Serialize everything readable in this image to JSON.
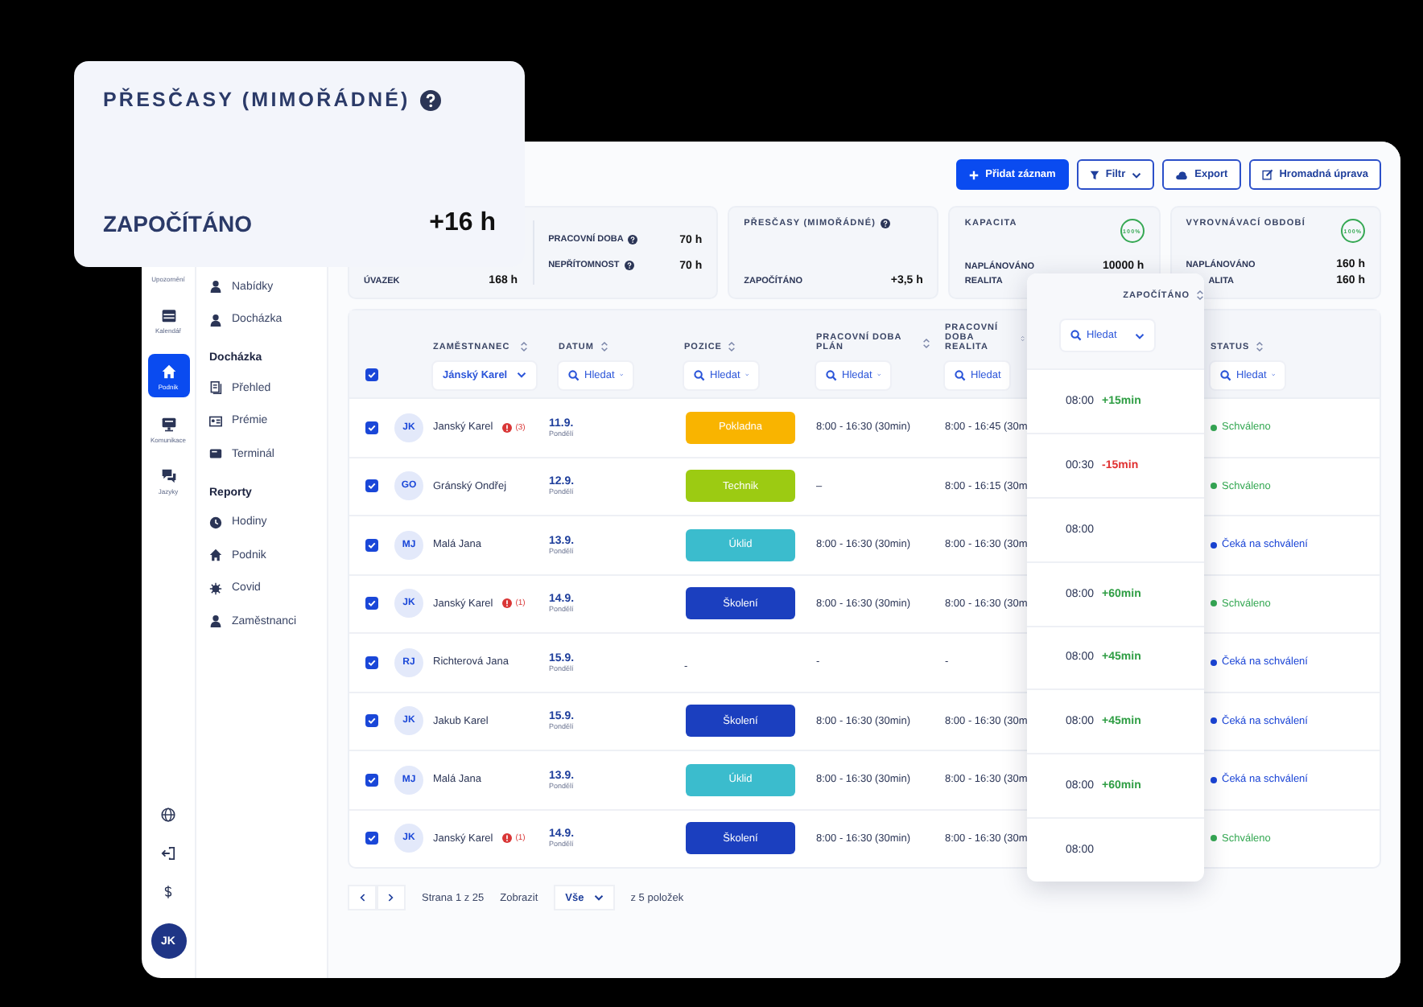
{
  "overlay_card": {
    "title": "PŘESČASY (MIMOŘÁDNÉ)",
    "help": true,
    "label": "ZAPOČÍTÁNO",
    "value": "+16 h"
  },
  "rail": {
    "items": [
      {
        "label": "Upozornění",
        "selected": false
      },
      {
        "label": "Kalendář",
        "selected": false
      },
      {
        "label": "Podnik",
        "selected": true
      },
      {
        "label": "Komunikace",
        "selected": false
      },
      {
        "label": "Jazyky",
        "selected": false
      }
    ],
    "avatar": "JK"
  },
  "nav": [
    {
      "items": [
        "Nabídky",
        "Docházka"
      ]
    },
    {
      "heading": "Docházka",
      "items": [
        "Přehled",
        "Prémie",
        "Terminál"
      ]
    },
    {
      "heading": "Reporty",
      "items": [
        "Hodiny",
        "Podnik",
        "Covid",
        "Zaměstnanci"
      ]
    }
  ],
  "toolbar": [
    {
      "label": "Přidat záznam",
      "kind": "primary"
    },
    {
      "label": "Filtr",
      "kind": "dropdown"
    },
    {
      "label": "Export",
      "kind": "export"
    },
    {
      "label": "Hromadná úprava",
      "kind": "edit"
    }
  ],
  "summary": [
    {
      "kind": "split",
      "rows": [
        {
          "label": "ÚVAZEK",
          "value": "168 h"
        }
      ],
      "side_rows": [
        {
          "label": "PRACOVNÍ DOBA",
          "value": "70 h",
          "help": true
        },
        {
          "label": "NEPŘÍTOMNOST",
          "value": "70 h",
          "help": true
        }
      ]
    },
    {
      "kind": "plain",
      "title": "PŘESČASY (MIMOŘÁDNÉ)",
      "help": true,
      "rows": [
        {
          "label": "ZAPOČÍTÁNO",
          "value": "+3,5 h"
        }
      ]
    },
    {
      "kind": "gauge",
      "title": "KAPACITA",
      "badge": "100%",
      "rows": [
        {
          "label": "NAPLÁNOVÁNO",
          "value": "10000 h"
        },
        {
          "label": "REALITA"
        }
      ]
    },
    {
      "kind": "gauge",
      "title": "VYROVNÁVACÍ OBDOBÍ",
      "badge": "100%",
      "rows": [
        {
          "label": "NAPLÁNOVÁNO",
          "value": "160 h"
        },
        {
          "label": "ALITA",
          "value": "160 h"
        }
      ]
    }
  ],
  "table": {
    "all_checked": true,
    "columns": [
      {
        "label": "ZAMĚSTNANEC",
        "filter": {
          "value": "Jánský Karel"
        }
      },
      {
        "label": "DATUM",
        "filter": {
          "placeholder": "Hledat"
        }
      },
      {
        "label": "POZICE",
        "filter": {
          "placeholder": "Hledat"
        }
      },
      {
        "label": "PRACOVNÍ DOBA PLÁN",
        "filter": {
          "placeholder": "Hledat"
        }
      },
      {
        "label": "PRACOVNÍ DOBA REALITA",
        "filter": {
          "placeholder": "Hledat"
        }
      },
      {
        "label": "STATUS",
        "filter": {
          "placeholder": "Hledat"
        }
      }
    ],
    "rows": [
      {
        "checked": true,
        "initials": "JK",
        "name": "Janský Karel",
        "alert": "(3)",
        "date": "11.9.",
        "day": "Pondělí",
        "position": {
          "label": "Pokladna",
          "color": "#f9b400"
        },
        "plan": "8:00 - 16:30 (30min)",
        "real": "8:00 - 16:45 (30m",
        "status": {
          "label": "Schváleno",
          "color": "#35a853"
        }
      },
      {
        "checked": true,
        "initials": "GO",
        "name": "Gránský Ondřej",
        "date": "12.9.",
        "day": "Pondělí",
        "position": {
          "label": "Technik",
          "color": "#9ccb12"
        },
        "plan": "–",
        "real": "8:00 - 16:15 (30m",
        "status": {
          "label": "Schváleno",
          "color": "#35a853"
        }
      },
      {
        "checked": true,
        "initials": "MJ",
        "name": "Malá Jana",
        "date": "13.9.",
        "day": "Pondělí",
        "position": {
          "label": "Úklid",
          "color": "#3bbccd"
        },
        "plan": "8:00 - 16:30 (30min)",
        "real": "8:00 - 16:30 (30m",
        "status": {
          "label": "Čeká na schválení",
          "color": "#1a44d6"
        }
      },
      {
        "checked": true,
        "initials": "JK",
        "name": "Janský Karel",
        "alert": "(1)",
        "date": "14.9.",
        "day": "Pondělí",
        "position": {
          "label": "Školení",
          "color": "#1b3fbf"
        },
        "plan": "8:00 - 16:30 (30min)",
        "real": "8:00 - 16:30 (30m",
        "status": {
          "label": "Schváleno",
          "color": "#35a853"
        }
      },
      {
        "checked": true,
        "initials": "RJ",
        "name": "Richterová Jana",
        "date": "15.9.",
        "day": "Pondělí",
        "position_text": "-",
        "plan": "-",
        "real": "-",
        "status": {
          "label": "Čeká na schválení",
          "color": "#1a44d6"
        }
      },
      {
        "checked": true,
        "initials": "JK",
        "name": "Jakub Karel",
        "date": "15.9.",
        "day": "Pondělí",
        "position": {
          "label": "Školení",
          "color": "#1b3fbf"
        },
        "plan": "8:00 - 16:30 (30min)",
        "real": "8:00 - 16:30 (30m",
        "status": {
          "label": "Čeká na schválení",
          "color": "#1a44d6"
        }
      },
      {
        "checked": true,
        "initials": "MJ",
        "name": "Malá Jana",
        "date": "13.9.",
        "day": "Pondělí",
        "position": {
          "label": "Úklid",
          "color": "#3bbccd"
        },
        "plan": "8:00 - 16:30 (30min)",
        "real": "8:00 - 16:30 (30m",
        "status": {
          "label": "Čeká na schválení",
          "color": "#1a44d6"
        }
      },
      {
        "checked": true,
        "initials": "JK",
        "name": "Janský Karel",
        "alert": "(1)",
        "date": "14.9.",
        "day": "Pondělí",
        "position": {
          "label": "Školení",
          "color": "#1b3fbf"
        },
        "plan": "8:00 - 16:30 (30min)",
        "real": "8:00 - 16:30 (30m",
        "status": {
          "label": "Schváleno",
          "color": "#35a853"
        }
      }
    ]
  },
  "pagination": {
    "page": "Strana 1 z 25",
    "show_label": "Zobrazit",
    "show_value": "Vše",
    "total": "z 5 položek"
  },
  "counted_column": {
    "title": "ZAPOČÍTÁNO",
    "filter": {
      "placeholder": "Hledat"
    },
    "rows": [
      {
        "time": "08:00",
        "delta": "+15min",
        "kind": "positive"
      },
      {
        "time": "00:30",
        "delta": "-15min",
        "kind": "negative"
      },
      {
        "time": "08:00"
      },
      {
        "time": "08:00",
        "delta": "+60min",
        "kind": "positive"
      },
      {
        "time": "08:00",
        "delta": "+45min",
        "kind": "positive"
      },
      {
        "time": "08:00",
        "delta": "+45min",
        "kind": "positive"
      },
      {
        "time": "08:00",
        "delta": "+60min",
        "kind": "positive"
      },
      {
        "time": "08:00"
      }
    ]
  }
}
